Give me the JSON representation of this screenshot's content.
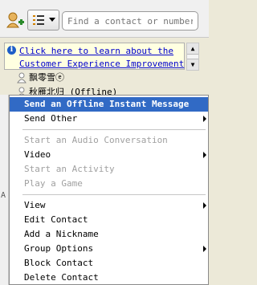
{
  "search": {
    "placeholder": "Find a contact or number..."
  },
  "notice": {
    "line1": "Click here to learn about the",
    "line2": "Customer Experience Improvement"
  },
  "contacts": [
    {
      "name": "飘零雪ⓔ"
    },
    {
      "name": "秋雁北归 (Offline)"
    }
  ],
  "left_label": "A",
  "menu": {
    "items": [
      {
        "label": "Send an Offline Instant Message",
        "state": "highlighted"
      },
      {
        "label": "Send Other",
        "submenu": true
      },
      {
        "label": "Start an Audio Conversation",
        "state": "disabled"
      },
      {
        "label": "Video",
        "submenu": true
      },
      {
        "label": "Start an Activity",
        "state": "disabled"
      },
      {
        "label": "Play a Game",
        "state": "disabled"
      },
      {
        "label": "View",
        "submenu": true
      },
      {
        "label": "Edit Contact"
      },
      {
        "label": "Add a Nickname"
      },
      {
        "label": "Group Options",
        "submenu": true
      },
      {
        "label": "Block Contact"
      },
      {
        "label": "Delete Contact"
      }
    ]
  },
  "colors": {
    "highlight": "#316ac5",
    "disabled": "#a0a0a0",
    "link": "#0000cc",
    "notice_bg": "#ffffe1"
  }
}
